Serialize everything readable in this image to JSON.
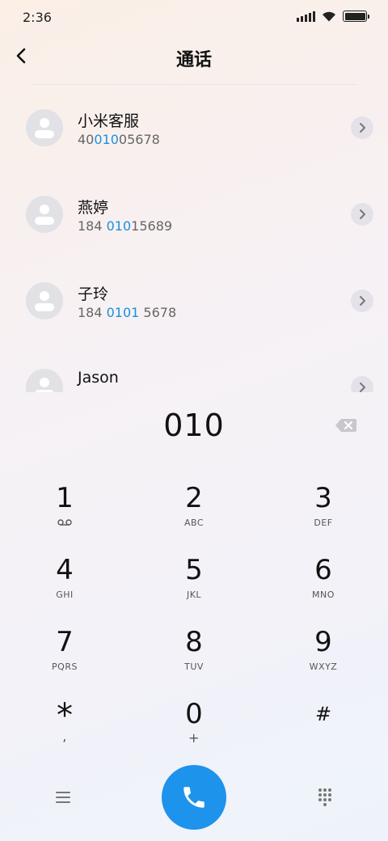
{
  "status_bar": {
    "time": "2:36",
    "battery_level": 1.0
  },
  "header": {
    "title": "通话",
    "back_icon": "chevron-left-icon"
  },
  "contacts": [
    {
      "name": "小米客服",
      "number_parts": [
        "40",
        "010",
        "05678"
      ],
      "highlight_index": 1
    },
    {
      "name": "燕婷",
      "number_parts": [
        "184 ",
        "010",
        "15689"
      ],
      "highlight_index": 1
    },
    {
      "name": "子玲",
      "number_parts": [
        "184 ",
        "0101",
        " 5678"
      ],
      "highlight_index": 1
    },
    {
      "name": "Jason",
      "number_parts": [
        "",
        "",
        ""
      ],
      "highlight_index": 1
    }
  ],
  "dialer": {
    "input": "010",
    "keys": [
      {
        "digit": "1",
        "letters": "voicemail"
      },
      {
        "digit": "2",
        "letters": "ABC"
      },
      {
        "digit": "3",
        "letters": "DEF"
      },
      {
        "digit": "4",
        "letters": "GHI"
      },
      {
        "digit": "5",
        "letters": "JKL"
      },
      {
        "digit": "6",
        "letters": "MNO"
      },
      {
        "digit": "7",
        "letters": "PQRS"
      },
      {
        "digit": "8",
        "letters": "TUV"
      },
      {
        "digit": "9",
        "letters": "WXYZ"
      },
      {
        "digit": "*",
        "letters": ","
      },
      {
        "digit": "0",
        "letters": "+"
      },
      {
        "digit": "#",
        "letters": ""
      }
    ]
  },
  "bottom_bar": {
    "menu_icon": "menu-icon",
    "call_icon": "phone-icon",
    "keypad_icon": "dialpad-icon"
  },
  "colors": {
    "accent": "#1d93ec",
    "highlight": "#1a8fe0"
  }
}
